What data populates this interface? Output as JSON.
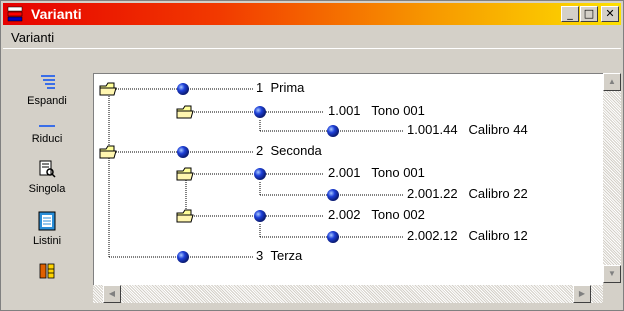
{
  "window": {
    "title": "Varianti",
    "minimize_glyph": "_",
    "maximize_glyph": "□",
    "close_glyph": "✕"
  },
  "menu": {
    "items": [
      "Varianti"
    ]
  },
  "sidebar": {
    "buttons": [
      {
        "label": "Espandi",
        "icon": "expand-icon"
      },
      {
        "label": "Riduci",
        "icon": "collapse-icon"
      },
      {
        "label": "Singola",
        "icon": "single-icon"
      },
      {
        "label": "Listini",
        "icon": "pricelist-icon"
      },
      {
        "label": "",
        "icon": "columns-icon"
      }
    ]
  },
  "tree": {
    "nodes": [
      {
        "code": "1",
        "name": "Prima"
      },
      {
        "code": "1.001",
        "name": "Tono 001"
      },
      {
        "code": "1.001.44",
        "name": "Calibro 44"
      },
      {
        "code": "2",
        "name": "Seconda"
      },
      {
        "code": "2.001",
        "name": "Tono 001"
      },
      {
        "code": "2.001.22",
        "name": "Calibro 22"
      },
      {
        "code": "2.002",
        "name": "Tono 002"
      },
      {
        "code": "2.002.12",
        "name": "Calibro 12"
      },
      {
        "code": "3",
        "name": "Terza"
      }
    ]
  },
  "colors": {
    "title_start": "#e60000",
    "title_end": "#fde000",
    "folder": "#ffff99",
    "ball": "#1e40d8"
  }
}
